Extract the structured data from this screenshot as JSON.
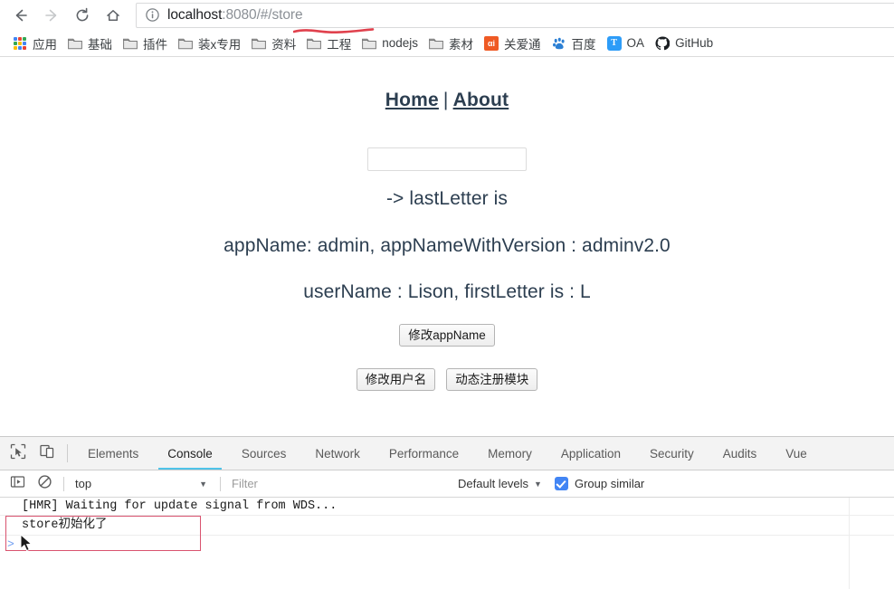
{
  "browser": {
    "nav": {
      "back_icon": "arrow-left-icon",
      "forward_icon": "arrow-right-icon",
      "reload_icon": "reload-icon",
      "home_icon": "home-icon"
    },
    "omnibox": {
      "info_icon": "info-circle-icon",
      "url_host": "localhost",
      "url_path": ":8080/#/store",
      "full_url": "localhost:8080/#/store"
    },
    "bookmarks": [
      {
        "label": "应用",
        "icon": "apps-grid-icon"
      },
      {
        "label": "基础",
        "icon": "folder-icon"
      },
      {
        "label": "插件",
        "icon": "folder-icon"
      },
      {
        "label": "装x专用",
        "icon": "folder-icon"
      },
      {
        "label": "资料",
        "icon": "folder-icon"
      },
      {
        "label": "工程",
        "icon": "folder-icon"
      },
      {
        "label": "nodejs",
        "icon": "folder-icon"
      },
      {
        "label": "素材",
        "icon": "folder-icon"
      },
      {
        "label": "关爱通",
        "icon": "guanaitong-icon"
      },
      {
        "label": "百度",
        "icon": "baidu-paw-icon"
      },
      {
        "label": "OA",
        "icon": "oa-icon"
      },
      {
        "label": "GitHub",
        "icon": "github-icon"
      }
    ]
  },
  "page": {
    "nav": {
      "home": "Home",
      "separator": "|",
      "about": "About"
    },
    "input": {
      "value": "",
      "placeholder": ""
    },
    "lines": {
      "last_letter": "-> lastLetter is",
      "app_name": "appName: admin, appNameWithVersion : adminv2.0",
      "user_name": "userName : Lison, firstLetter is : L"
    },
    "buttons": {
      "change_appname": "修改appName",
      "change_username": "修改用户名",
      "register_module": "动态注册模块"
    }
  },
  "devtools": {
    "tools": {
      "inspect_icon": "inspect-element-icon",
      "device_icon": "device-toolbar-icon"
    },
    "tabs": [
      {
        "label": "Elements",
        "active": false
      },
      {
        "label": "Console",
        "active": true
      },
      {
        "label": "Sources",
        "active": false
      },
      {
        "label": "Network",
        "active": false
      },
      {
        "label": "Performance",
        "active": false
      },
      {
        "label": "Memory",
        "active": false
      },
      {
        "label": "Application",
        "active": false
      },
      {
        "label": "Security",
        "active": false
      },
      {
        "label": "Audits",
        "active": false
      },
      {
        "label": "Vue",
        "active": false
      }
    ],
    "console_toolbar": {
      "execute_icon": "console-sidebar-icon",
      "clear_icon": "clear-console-icon",
      "context": "top",
      "context_caret": "▼",
      "filter_placeholder": "Filter",
      "filter_value": "",
      "levels": "Default levels",
      "levels_caret": "▼",
      "group_similar": "Group similar",
      "group_similar_checked": true
    },
    "console_messages": [
      "[HMR] Waiting for update signal from WDS...",
      "store初始化了"
    ],
    "prompt": ">"
  },
  "annotations": {
    "url_underline_color": "#e0414d",
    "console_box_color": "#d9536f",
    "cursor_icon": "mouse-pointer-icon"
  }
}
